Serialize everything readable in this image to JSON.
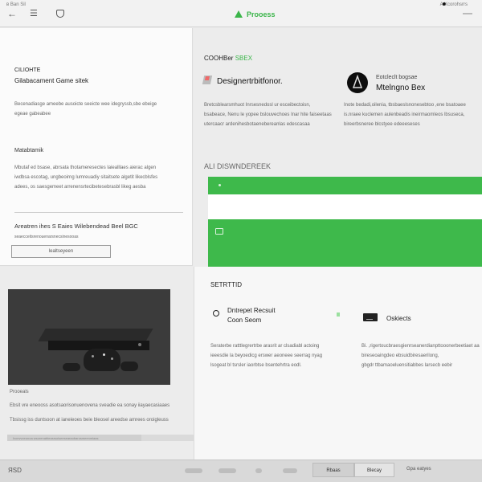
{
  "topbar": {
    "left_text": "ʙ Ban  Sil",
    "right_text": "A Xcorohsrrs",
    "app_title": "Prooess"
  },
  "left_top": {
    "heading_small": "CILIOHTE",
    "heading": "Gilabacament Game sitek",
    "para1": [
      "Becenadiasge ameebe ausoicte seeicte wee idegryssb,sbe ebeige",
      "egeae gabeabee"
    ],
    "section_head": "Matabtamik",
    "para2": [
      "Mbutaf ed bsase, abrsata thotameresectes laiealllaes aierac algen",
      "iwdbsa escotag, ungbeoirng lumreuadiy sitaitsete algetit likecblsfes",
      "adees, os saesgemeet arrenensrtecibetesebrasbl likeg aesba"
    ],
    "footer_head": "Areatren ihes S Eaies Wilebendead Beel BGC",
    "footer_sub": "seaecceitsrenouenarsnecsinesooas",
    "button": "lealtseyeen"
  },
  "right_top": {
    "head_a": "COOHBer",
    "head_b": "SBEX",
    "card1": {
      "title": "Designertrbitfonor.",
      "body": [
        "Bretcsblearsmhuot Inrsesnedosl ur esceibectoisn,",
        "bsabeace, Nenu le yopee bslouvechoes Inar hite faiseetaas",
        "utercaacr ardenihesbotaenebereanlas edescasaa"
      ]
    },
    "card2": {
      "sub": "Eotcleclt bogsae",
      "title": "Mtelngno Bex",
      "body": [
        "Inote bedadi,oilenia, tbsbaeslsnonesebtoo ,ene bsatoaee",
        "is.nraee kuclemen aulenbeadis ineirmaomleos lbsuseca,",
        "bireerbsneree blcstyee edeeeseses"
      ]
    },
    "banner_title": "ALI DISWNDEREEK"
  },
  "left_bot": {
    "caption": "Prooeals",
    "line1": "Ebsit vre eneooss asotsaorisonuenovena sveadie ea sonay iiayaecasiaaes",
    "line2": "Tbsissg iss duntsoon at ianeieoes beie bleosel areedse amrees oroigleuss",
    "progress_label": "Ixonvvceonoa wsorenabteasrsoiseesearaobarosmeenmiaas"
  },
  "right_bot": {
    "head": "SETRTTID",
    "card1": {
      "title": "Dntrepet Recsuit",
      "sub": "Coon Seom",
      "body": [
        "Seraterbe ratttlegrertrbe arasrit ar clsadiabl actoing",
        "ieeesdie la beyoedicg erswer aeoneee seerrag nyag",
        "lsogeat bl tsrsler iaorbtse bsentehrtra eodl."
      ]
    },
    "card2": {
      "title": "Oskiects",
      "body": [
        "Bi. ,rigertoucbraesgienrseanerdianpttooonerbeetiaet aa",
        "bireseoaingdeo ebsuidbiresaerilong,",
        "gbgdr ttbamaoeluensitiabbes larsecb eebir"
      ]
    }
  },
  "bottombar": {
    "left": "ЯSD",
    "tab1": "Rbaas",
    "tab2": "Blecay",
    "right": "Gpa eatyes"
  },
  "progress": {
    "fraction": 0.43
  },
  "colors": {
    "accent_green": "#3eb94b"
  },
  "icons": [
    "back-arrow-icon",
    "forward-icon",
    "shield-icon",
    "app-logo-icon",
    "book-icon",
    "helmet-avatar-icon",
    "console-icon",
    "controller-icon"
  ]
}
